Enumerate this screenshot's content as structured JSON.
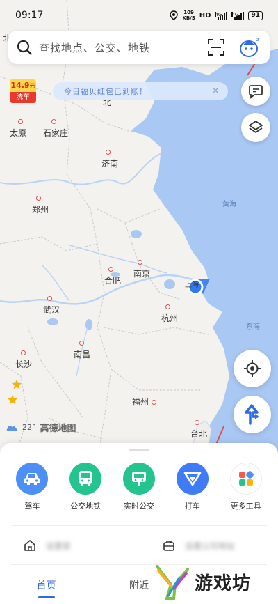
{
  "status_bar": {
    "time": "09:17",
    "net_speed_value": "109",
    "net_speed_unit": "KB/S",
    "hd_label": "HD",
    "signal_1_gen": "4G",
    "signal_2_gen": "4G",
    "battery": "91"
  },
  "search": {
    "placeholder": "查找地点、公交、地铁"
  },
  "promo": {
    "carwash_price": "14.9",
    "carwash_unit": "元",
    "carwash_label": "洗车"
  },
  "notice": {
    "text": "今日福贝红包已到账！"
  },
  "map": {
    "cities": {
      "taiyuan": "太原",
      "shijiazhuang": "石家庄",
      "jinan": "济南",
      "zhengzhou": "郑州",
      "hefei": "合肥",
      "nanjing": "南京",
      "shanghai": "上海",
      "hangzhou": "杭州",
      "wuhan": "武汉",
      "nanchang": "南昌",
      "changsha": "长沙",
      "fuzhou": "福州",
      "taibei": "台北",
      "bei": "北"
    },
    "seas": {
      "yellow_sea": "黄海",
      "east_sea": "东海"
    },
    "colors": {
      "land": "#f3f2ef",
      "sea": "#a9c8f4",
      "location": "#2f7af0"
    }
  },
  "weather": {
    "temperature": "22°",
    "brand": "高德地图"
  },
  "quick_actions": [
    {
      "label": "驾车",
      "icon": "car-icon",
      "color": "#4b8ff7"
    },
    {
      "label": "公交地铁",
      "icon": "bus-icon",
      "color": "#23c48e"
    },
    {
      "label": "实时公交",
      "icon": "realtime-bus-icon",
      "color": "#23c48e"
    },
    {
      "label": "打车",
      "icon": "taxi-icon",
      "color": "#3f7bf5"
    },
    {
      "label": "更多工具",
      "icon": "more-tools-icon",
      "color": "#ffffff"
    }
  ],
  "places": {
    "home": "设置家",
    "work": "设置公司地址"
  },
  "tabs": {
    "home": "首页",
    "nearby": "附近"
  },
  "watermark": {
    "text": "游戏坊"
  }
}
